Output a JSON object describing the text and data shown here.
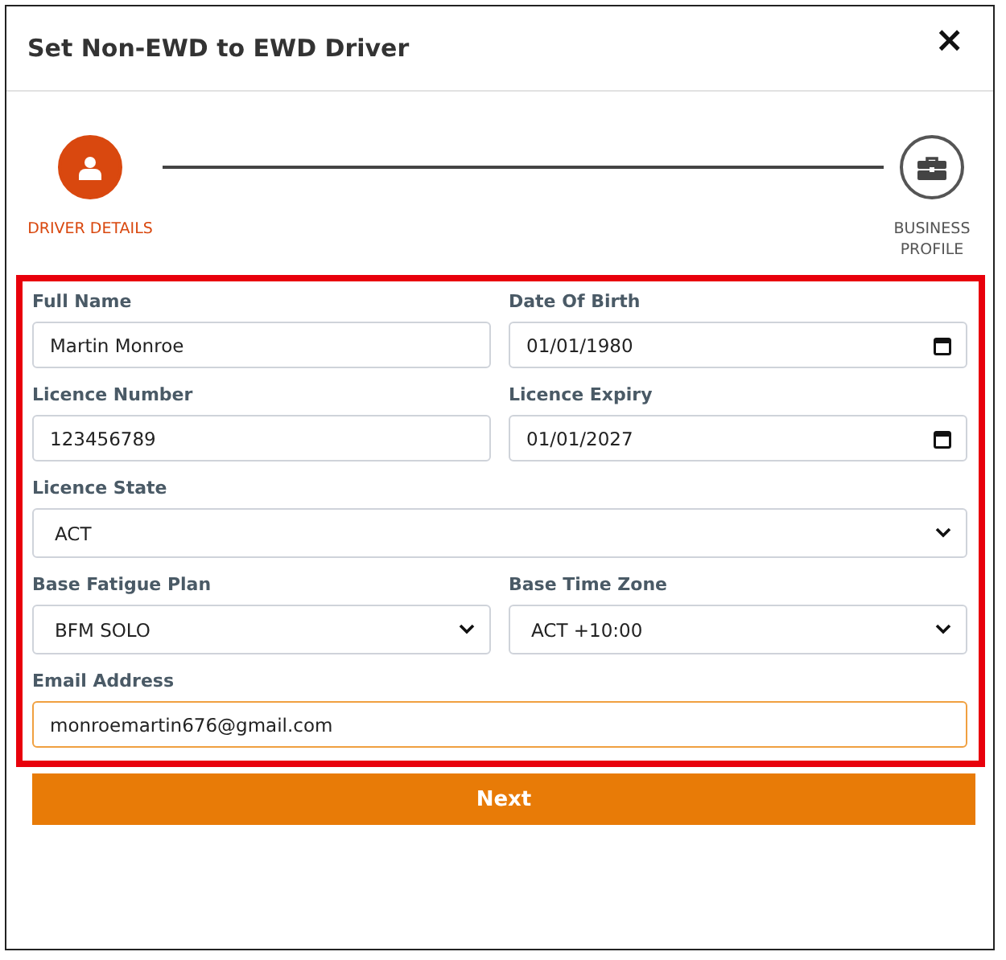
{
  "dialog": {
    "title": "Set Non-EWD to EWD Driver",
    "close": "×"
  },
  "steps": [
    {
      "label": "DRIVER DETAILS",
      "kind": "driver",
      "selected": true
    },
    {
      "label": "BUSINESS PROFILE",
      "kind": "business",
      "selected": false
    }
  ],
  "form": {
    "highlighted": true,
    "rows": [
      [
        {
          "label": "Full Name",
          "kind": "text",
          "value": "Martin Monroe",
          "focused": false
        },
        {
          "label": "Date Of Birth",
          "kind": "date",
          "value": "01/01/1980",
          "focused": false
        }
      ],
      [
        {
          "label": "Licence Number",
          "kind": "text",
          "value": "123456789",
          "focused": false
        },
        {
          "label": "Licence Expiry",
          "kind": "date",
          "value": "01/01/2027",
          "focused": false
        }
      ],
      [
        {
          "label": "Licence State",
          "kind": "select",
          "value": "ACT",
          "focused": false
        }
      ],
      [
        {
          "label": "Base Fatigue Plan",
          "kind": "select",
          "value": "BFM SOLO",
          "focused": false
        },
        {
          "label": "Base Time Zone",
          "kind": "select",
          "value": "ACT +10:00",
          "focused": false
        }
      ],
      [
        {
          "label": "Email Address",
          "kind": "text",
          "value": "monroemartin676@gmail.com",
          "focused": true
        }
      ]
    ]
  },
  "next_button": "Next"
}
